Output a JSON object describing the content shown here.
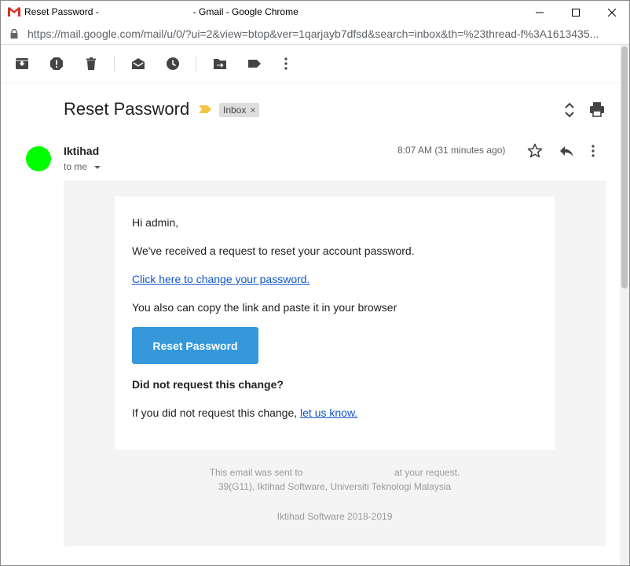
{
  "window": {
    "title": "Reset Password -                                    - Gmail - Google Chrome",
    "url": "https://mail.google.com/mail/u/0/?ui=2&view=btop&ver=1qarjayb7dfsd&search=inbox&th=%23thread-f%3A1613435..."
  },
  "toolbar": {
    "icons": [
      "archive-icon",
      "report-spam-icon",
      "delete-icon",
      "mark-unread-icon",
      "snooze-icon",
      "move-to-icon",
      "labels-icon",
      "more-vert-icon"
    ]
  },
  "thread": {
    "subject": "Reset Password",
    "label": "Inbox",
    "label_remove": "×"
  },
  "message": {
    "sender": "Iktihad",
    "recipient": "to me",
    "time": "8:07 AM (31 minutes ago)",
    "avatar_color": "#00ff00"
  },
  "email": {
    "greeting": "Hi admin,",
    "intro": "We've received a request to reset your account password.",
    "link_text": "Click here to change your password.",
    "copy_text": "You also can copy the link and paste it in your browser",
    "button_label": "Reset Password",
    "button_color": "#3498db",
    "question": "Did not request this change?",
    "if_not_prefix": "If you did not request this change, ",
    "let_us_know": "let us know.",
    "footer_sent": "This email was sent to                                   at your request.",
    "footer_address": "39(G11), Iktihad Software, Universiti Teknologi Malaysia",
    "footer_copyright": "Iktihad Software 2018-2019"
  }
}
